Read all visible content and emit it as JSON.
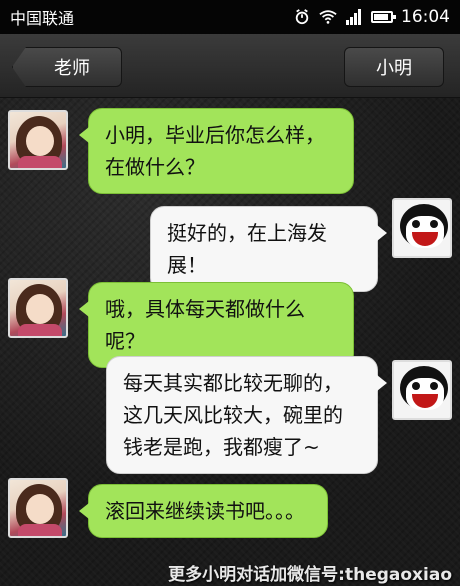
{
  "status_bar": {
    "carrier": "中国联通",
    "time": "16:04"
  },
  "nav": {
    "back_label": "老师",
    "title": "小明"
  },
  "messages": [
    {
      "sender": "teacher",
      "lines": [
        "小明，毕业后你怎么样，",
        "在做什么？"
      ]
    },
    {
      "sender": "xiaoming",
      "lines": [
        "挺好的，在上海发展！"
      ]
    },
    {
      "sender": "teacher",
      "lines": [
        "哦，具体每天都做什么呢？"
      ]
    },
    {
      "sender": "xiaoming",
      "lines": [
        "每天其实都比较无聊的，",
        "这几天风比较大，碗里的",
        "钱老是跑，我都瘦了~"
      ]
    },
    {
      "sender": "teacher",
      "lines": [
        "滚回来继续读书吧。。。"
      ]
    }
  ],
  "watermark": "更多小明对话加微信号:thegaoxiao",
  "colors": {
    "sent_bubble": "#a2e45a",
    "received_bubble": "#f7f7f7"
  }
}
